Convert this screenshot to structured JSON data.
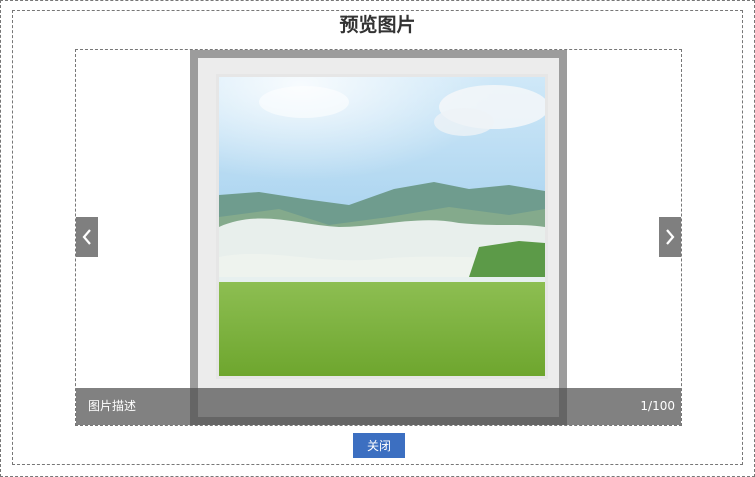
{
  "dialog": {
    "title": "预览图片",
    "close_label": "关闭"
  },
  "viewer": {
    "caption": "图片描述",
    "counter": "1/100",
    "prev_icon": "chevron-left-icon",
    "next_icon": "chevron-right-icon"
  },
  "colors": {
    "close_button": "#3c6fc1",
    "nav_button": "#7f7f7f",
    "caption_bar": "#505050"
  }
}
